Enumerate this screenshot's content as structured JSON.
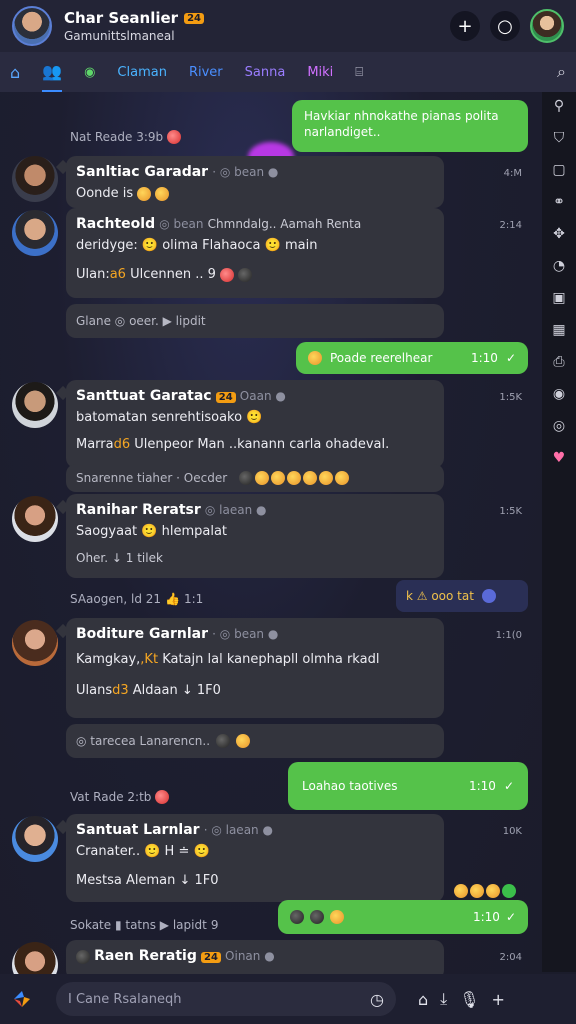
{
  "header": {
    "title": "Char Seanlier",
    "badge": "24",
    "subtitle": "Gamunittslmaneal"
  },
  "tabs": [
    {
      "label": "Claman",
      "icon": "people-icon"
    },
    {
      "label": "River"
    },
    {
      "label": "Sanna"
    },
    {
      "label": "Miki"
    }
  ],
  "messages": {
    "out1": "Havkiar nhnokathe pianas polita narlandiget..",
    "sys1": "Nat Reade 3:9b",
    "m1": {
      "name": "Sanltiac Garadar",
      "meta": "· ◎ bean ●",
      "line": "Oonde is",
      "time": "4:M"
    },
    "m2": {
      "name": "Rachteold",
      "meta": "◎ bean",
      "line1": "Chmndalg..  Aamah Renta",
      "line2": "deridyge: 🙂 olima Flahaoca 🙂 main",
      "line3a": "Ulan:",
      "line3b": "a6",
      "line3c": "Ulcennen ..",
      "line3d": "9",
      "foot": "Glane ◎ oeer. ▶ lipdit",
      "time": "2:14"
    },
    "out2": {
      "text": "Poade reerelhear",
      "time": "1:10"
    },
    "m3": {
      "name": "Santtuat Garatac",
      "badge": "24",
      "meta": "Oaan ●",
      "line1": "batomatan senrehtisoako 🙂",
      "line2a": "Marra",
      "line2b": "d6",
      "line2c": "Ulenpeor Man ..kanann carla ohadeval.",
      "foot": "Snarenne tiaher  ·  Oecder",
      "time": "1:5K"
    },
    "m4": {
      "name": "Ranihar Reratsr",
      "meta": "◎ laean ●",
      "line1": "Saogyaat 🙂 hlempalat",
      "line2": "Oher.  ↓ 1 tilek",
      "time": "1:5K"
    },
    "sys2": "SAaogen, ld 21",
    "sys2b": "1:1",
    "strip": "k  ⚠ ooo  tat",
    "m5": {
      "name": "Boditure Garnlar",
      "meta": "· ◎ bean ●",
      "line1a": "Kamgkay,",
      "line1b": ",Kt",
      "line1c": "Katajn lal kanephapll olmha rkadl",
      "line2a": "Ulans",
      "line2b": "d3",
      "line2c": "Aldaan  ↓ 1F0",
      "foot": "◎ tarecea Lanarencn..",
      "time": "1:1(0"
    },
    "out3": {
      "text": "Loahao taotives",
      "time": "1:10"
    },
    "sys3": "Vat Rade 2:tb",
    "m6": {
      "name": "Santuat Larnlar",
      "meta": "· ◎ laean ●",
      "line1": "Cranater.. 🙂 H ≐ 🙂",
      "line2": "Mestsa  Aleman  ↓ 1F0",
      "time": "10K"
    },
    "sys4": "Sokate  ▮ tatns  ▶ lapidt",
    "sys4b": "9",
    "out4": {
      "time": "1:10"
    },
    "m7": {
      "name": "Raen Reratig",
      "badge": "24",
      "meta": "Oinan ●",
      "time": "2:04"
    }
  },
  "composer": {
    "placeholder": "I Cane Rsalaneqh"
  },
  "colors": {
    "accent": "#55c24a",
    "brand": "#3b8cff"
  }
}
